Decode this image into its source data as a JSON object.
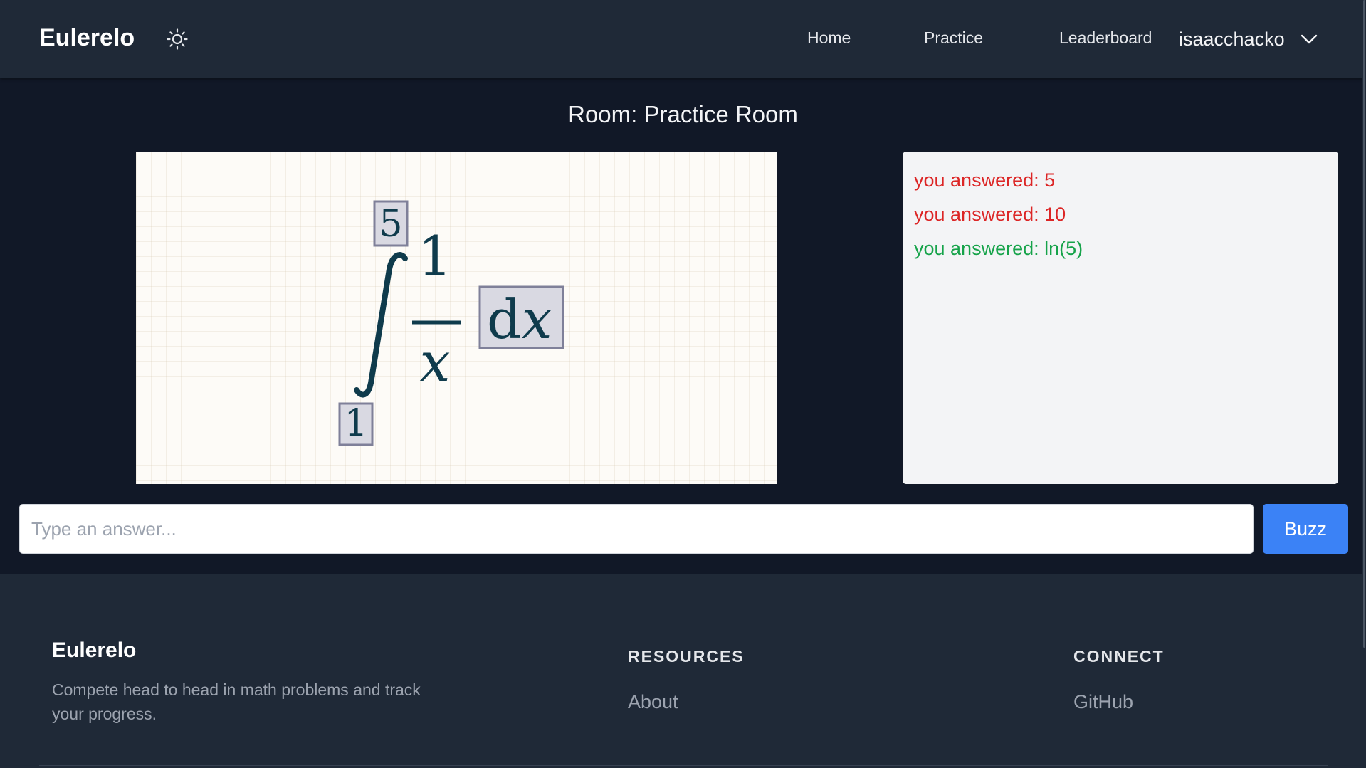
{
  "header": {
    "brand": "Eulerelo",
    "theme_icon": "sun-icon",
    "nav": [
      {
        "label": "Home"
      },
      {
        "label": "Practice"
      },
      {
        "label": "Leaderboard"
      }
    ],
    "user": {
      "name": "isaacchacko",
      "menu_icon": "chevron-down-icon"
    }
  },
  "room": {
    "title": "Room: Practice Room"
  },
  "problem": {
    "upper_limit": "5",
    "lower_limit": "1",
    "numerator": "1",
    "denominator": "x",
    "differential_d": "d",
    "differential_var": "x"
  },
  "feed": {
    "items": [
      {
        "text": "you answered: 5",
        "status": "wrong"
      },
      {
        "text": "you answered: 10",
        "status": "wrong"
      },
      {
        "text": "you answered: ln(5)",
        "status": "correct"
      }
    ]
  },
  "answer": {
    "placeholder": "Type an answer...",
    "value": "",
    "buzz_label": "Buzz"
  },
  "footer": {
    "brand": "Eulerelo",
    "tagline": "Compete head to head in math problems and track your progress.",
    "resources": {
      "heading": "RESOURCES",
      "links": [
        "About"
      ]
    },
    "connect": {
      "heading": "CONNECT",
      "links": [
        "GitHub"
      ]
    }
  },
  "colors": {
    "page_bg": "#111827",
    "header_bg": "#1f2937",
    "accent": "#3b82f6",
    "wrong": "#dc2626",
    "correct": "#16a34a",
    "math_ink": "#0f3b4c"
  }
}
